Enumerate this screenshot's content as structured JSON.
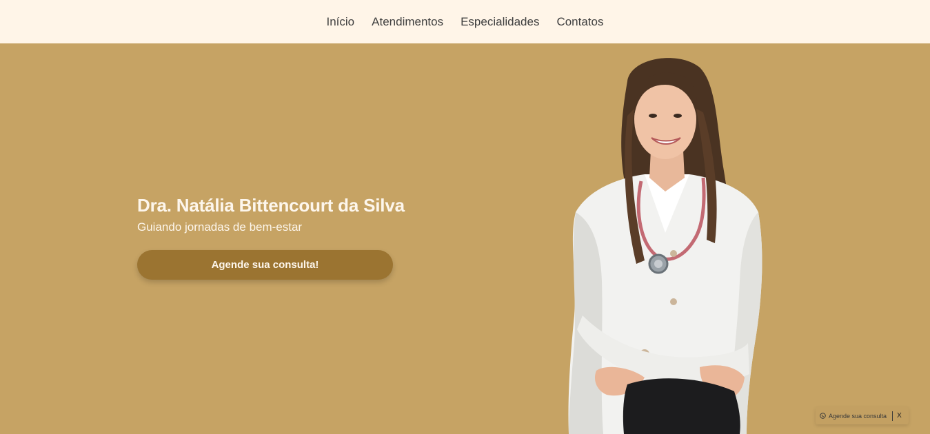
{
  "nav": {
    "items": [
      {
        "label": "Início"
      },
      {
        "label": "Atendimentos"
      },
      {
        "label": "Especialidades"
      },
      {
        "label": "Contatos"
      }
    ]
  },
  "hero": {
    "name": "Dra. Natália Bittencourt da Silva",
    "tagline": "Guiando jornadas de bem-estar",
    "cta_label": "Agende sua consulta!",
    "background_color": "#c6a364",
    "cta_color": "#9b7431"
  },
  "whatsapp_widget": {
    "icon": "whatsapp-icon",
    "label": "Agende sua consulta",
    "close_label": "X"
  }
}
